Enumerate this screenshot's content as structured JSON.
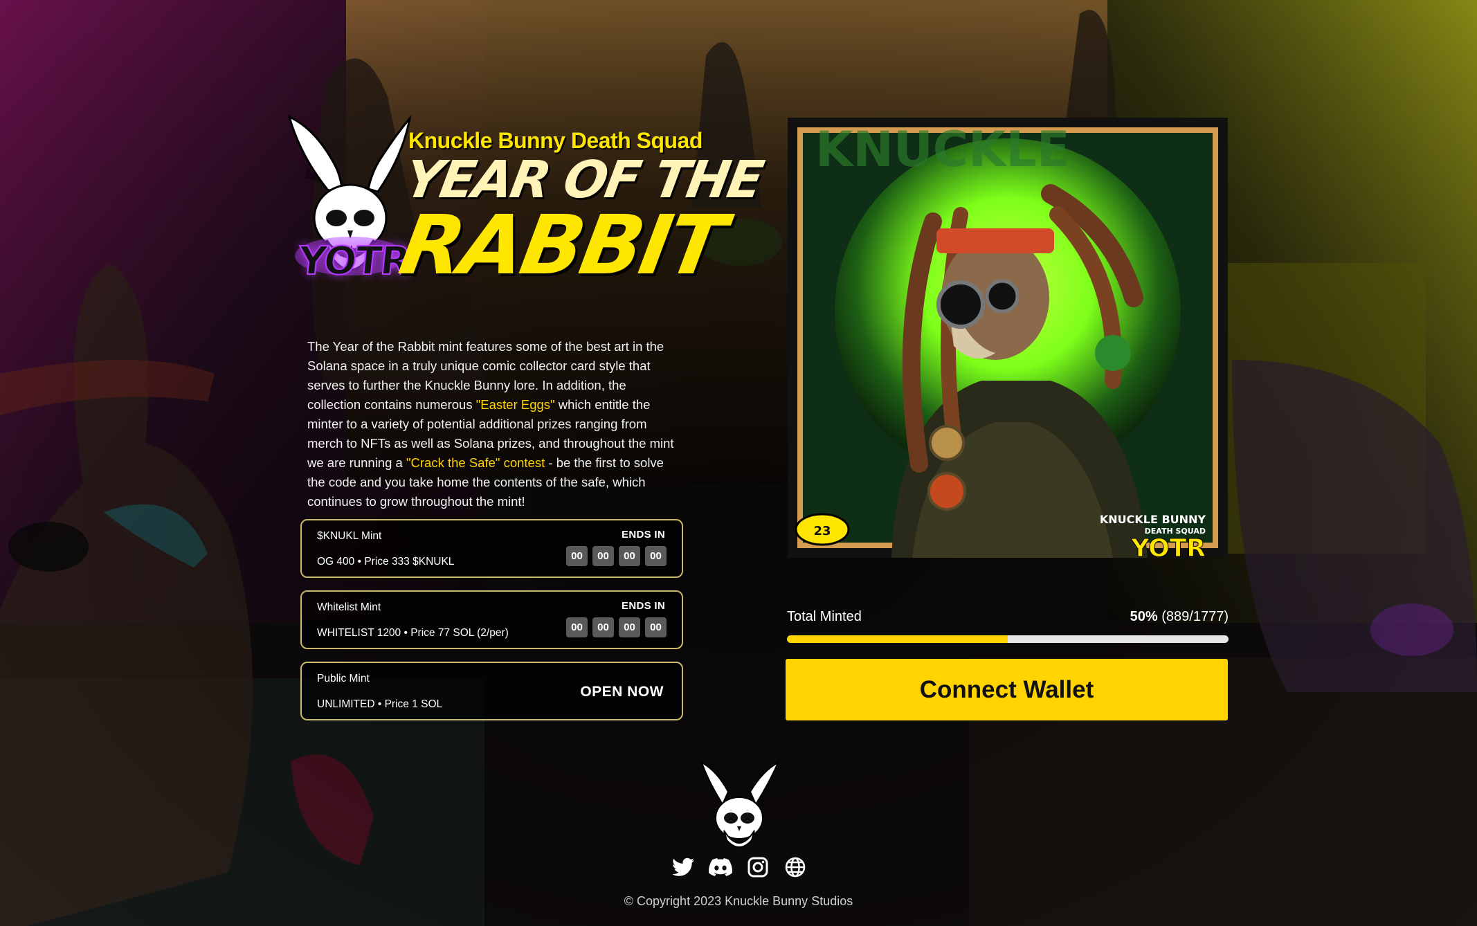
{
  "brand": {
    "collection_name": "Knuckle Bunny Death Squad",
    "headline_line1": "YEAR OF THE",
    "headline_line2": "RABBIT",
    "logo_badge": "YOTR"
  },
  "description": {
    "part1": "The Year of the Rabbit mint features some of the best art in the Solana space in a truly unique comic collector card style that serves to further the Knuckle Bunny lore. In addition, the collection contains numerous ",
    "easter_eggs": "\"Easter Eggs\"",
    "part2": " which entitle the minter to a variety of potential additional prizes ranging from merch to NFTs as well as Solana prizes, and throughout the mint we are running a ",
    "contest_quoted": "\"Crack the Safe\"",
    "contest_word": " contest",
    "part3": " - be the first to solve the code and you take home the contents of the safe, which continues to grow throughout the mint!"
  },
  "mint_phases": [
    {
      "name": "$KNUKL Mint",
      "detail": "OG 400 • Price 333 $KNUKL",
      "status_label": "ENDS IN",
      "countdown": [
        "00",
        "00",
        "00",
        "00"
      ]
    },
    {
      "name": "Whitelist Mint",
      "detail": "WHITELIST 1200 • Price 77 SOL (2/per)",
      "status_label": "ENDS IN",
      "countdown": [
        "00",
        "00",
        "00",
        "00"
      ]
    },
    {
      "name": "Public Mint",
      "detail": "UNLIMITED • Price 1 SOL",
      "status_label": "OPEN NOW"
    }
  ],
  "card": {
    "badge_brand_line1": "KNUCKLE BUNNY",
    "badge_brand_line2": "DEATH SQUAD",
    "badge_yotr": "YOTR",
    "knuckle_number": "23"
  },
  "minting": {
    "label": "Total Minted",
    "percent_text": "50%",
    "count_text": "(889/1777)",
    "minted": 889,
    "total": 1777
  },
  "actions": {
    "connect_wallet": "Connect Wallet"
  },
  "socials": [
    "twitter-icon",
    "discord-icon",
    "instagram-icon",
    "globe-icon"
  ],
  "footer": {
    "copyright": "© Copyright 2023 Knuckle Bunny Studios"
  },
  "colors": {
    "accent": "#ffd400",
    "card_border": "#c9b968",
    "logo_purple": "#b43cff",
    "card_green": "#7dff1a"
  }
}
